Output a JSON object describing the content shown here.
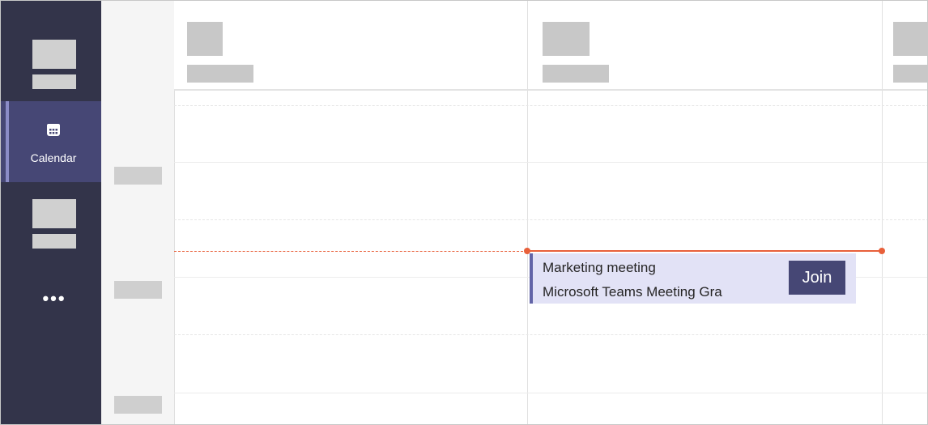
{
  "rail": {
    "items": [
      {
        "label": "Calendar",
        "icon": "calendar-icon",
        "active": true
      },
      {
        "label": "",
        "icon": "more-icon"
      }
    ],
    "more_symbol": "•••",
    "colors": {
      "background": "#33344a",
      "active": "#464775",
      "indicator": "#8b8cc7"
    }
  },
  "event": {
    "title": "Marketing meeting",
    "subtitle": "Microsoft Teams Meeting Gra",
    "join_label": "Join",
    "colors": {
      "background": "#e2e2f6",
      "accent": "#6264a7",
      "button": "#464775"
    }
  },
  "now_line_color": "#e8603a"
}
